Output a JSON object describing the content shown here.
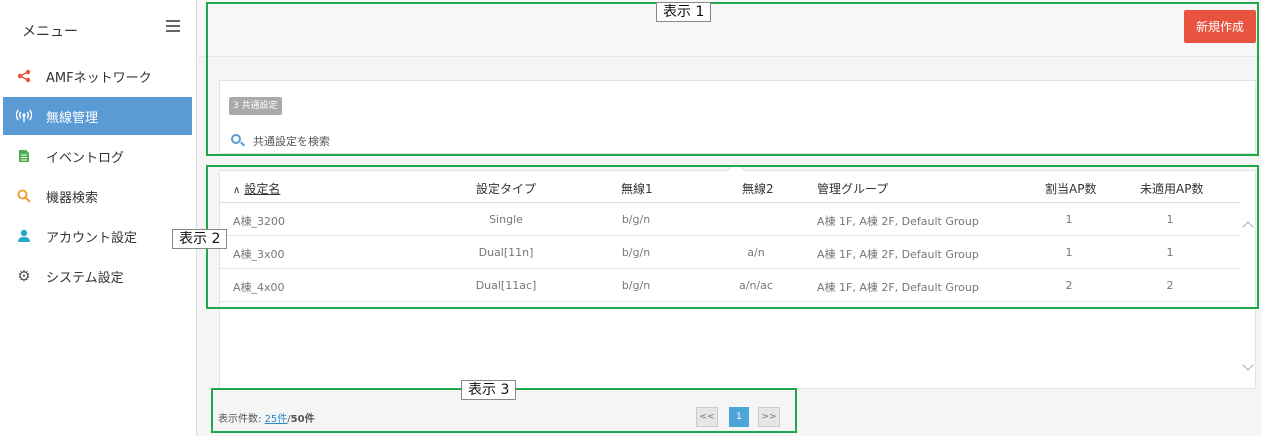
{
  "sidebar": {
    "title": "メニュー",
    "items": [
      {
        "label": "AMFネットワーク",
        "icon": "share-icon",
        "color": "#e8533f"
      },
      {
        "label": "無線管理",
        "icon": "wireless-icon",
        "color": "#ffffff",
        "active": true
      },
      {
        "label": "イベントログ",
        "icon": "document-icon",
        "color": "#4caf50"
      },
      {
        "label": "機器検索",
        "icon": "search-icon",
        "color": "#f0a030"
      },
      {
        "label": "アカウント設定",
        "icon": "user-icon",
        "color": "#26a6c8"
      },
      {
        "label": "システム設定",
        "icon": "gear-icon",
        "color": "#555555"
      }
    ]
  },
  "toolbar": {
    "new_label": "新規作成"
  },
  "common": {
    "count_badge": "3 共通設定",
    "search_placeholder": "共通設定を検索"
  },
  "table": {
    "sort_indicator": "∧",
    "columns": [
      "設定名",
      "設定タイプ",
      "無線1",
      "無線2",
      "管理グループ",
      "割当AP数",
      "未適用AP数"
    ],
    "rows": [
      [
        "A棟_3200",
        "Single",
        "b/g/n",
        "",
        "A棟 1F, A棟 2F, Default Group",
        "1",
        "1"
      ],
      [
        "A棟_3x00",
        "Dual[11n]",
        "b/g/n",
        "a/n",
        "A棟 1F, A棟 2F, Default Group",
        "1",
        "1"
      ],
      [
        "A棟_4x00",
        "Dual[11ac]",
        "b/g/n",
        "a/n/ac",
        "A棟 1F, A棟 2F, Default Group",
        "2",
        "2"
      ]
    ]
  },
  "footer": {
    "per_page_label": "表示件数:",
    "per_page_value": "25件",
    "separator": "/",
    "total": "50件",
    "prev": "<<",
    "current_page": "1",
    "next": ">>"
  },
  "annotations": [
    "表示 1",
    "表示 2",
    "表示 3"
  ],
  "colors": {
    "accent": "#5b9bd5",
    "new_button": "#e8533f",
    "annotation": "#1fa84a",
    "page_active": "#4ba5d8"
  }
}
